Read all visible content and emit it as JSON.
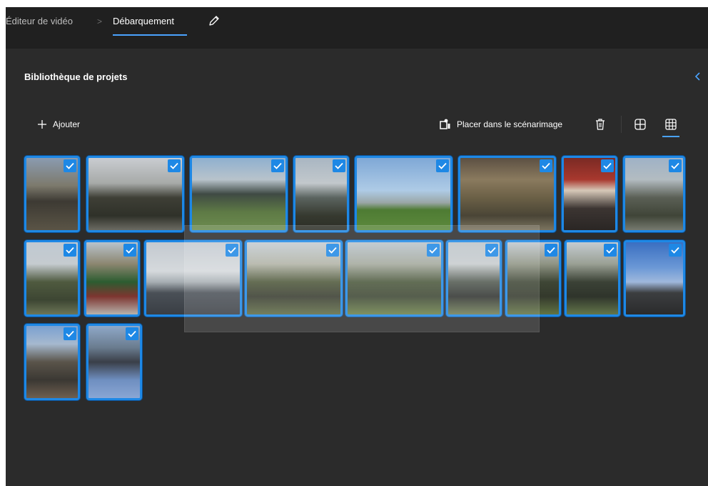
{
  "titlebar": {
    "root_label": "Éditeur de vidéo",
    "separator": ">",
    "current_project": "Débarquement"
  },
  "library": {
    "title": "Bibliothèque de projets"
  },
  "toolbar": {
    "add_label": "Ajouter",
    "place_label": "Placer dans le scénarimage"
  },
  "icons": {
    "edit": "pencil-icon",
    "collapse": "chevron-left-icon",
    "add": "plus-icon",
    "place": "storyboard-icon",
    "delete": "trash-icon",
    "large_grid": "large-grid-icon",
    "small_grid": "small-grid-icon",
    "selected": "checkmark-icon"
  },
  "colors": {
    "accent": "#1e88e5",
    "title_background": "#202020",
    "panel_background": "#2b2b2b"
  },
  "clips": [
    {
      "selected": true
    },
    {
      "selected": true
    },
    {
      "selected": true
    },
    {
      "selected": true
    },
    {
      "selected": true
    },
    {
      "selected": true
    },
    {
      "selected": true
    },
    {
      "selected": true
    },
    {
      "selected": true
    },
    {
      "selected": true
    },
    {
      "selected": true
    },
    {
      "selected": true
    },
    {
      "selected": true
    },
    {
      "selected": true
    },
    {
      "selected": true
    },
    {
      "selected": true
    },
    {
      "selected": true
    },
    {
      "selected": true
    },
    {
      "selected": true
    }
  ]
}
